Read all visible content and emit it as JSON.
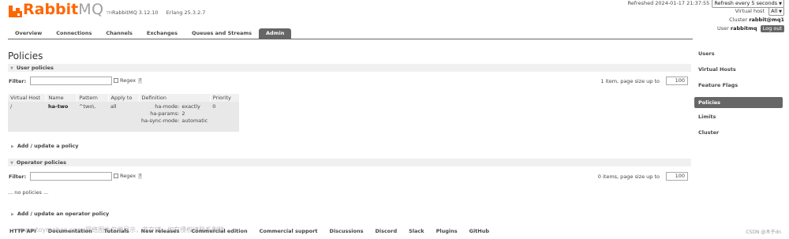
{
  "header": {
    "logo_rabbit": "Rabbit",
    "logo_mq": "MQ",
    "logo_tm": "TM",
    "version_rabbitmq": "RabbitMQ 3.12.10",
    "version_erlang": "Erlang 25.3.2.7",
    "refreshed": "Refreshed 2024-01-17 21:37:55",
    "refresh_select": "Refresh every 5 seconds",
    "virtual_host_label": "Virtual host",
    "virtual_host_value": "All",
    "cluster_label": "Cluster",
    "cluster_value": "rabbit@mq1",
    "user_label": "User",
    "user_value": "rabbitmq",
    "logout_label": "Log out"
  },
  "tabs": [
    "Overview",
    "Connections",
    "Channels",
    "Exchanges",
    "Queues and Streams",
    "Admin"
  ],
  "active_tab": "Admin",
  "page_title": "Policies",
  "user_policies": {
    "header": "User policies",
    "filter_label": "Filter:",
    "regex_label": "Regex",
    "help": "?",
    "page_info": "1 item, page size up to",
    "page_size": "100",
    "columns": [
      "Virtual Host",
      "Name",
      "Pattern",
      "Apply to",
      "Definition",
      "Priority"
    ],
    "row": {
      "vhost": "/",
      "name": "ha-two",
      "pattern": "^two\\.",
      "apply_to": "all",
      "definition": [
        {
          "key": "ha-mode:",
          "value": "exactly"
        },
        {
          "key": "ha-params:",
          "value": "2"
        },
        {
          "key": "ha-sync-mode:",
          "value": "automatic"
        }
      ],
      "priority": "0"
    },
    "add_link": "Add / update a policy"
  },
  "operator_policies": {
    "header": "Operator policies",
    "filter_label": "Filter:",
    "regex_label": "Regex",
    "help": "?",
    "page_info": "0 items, page size up to",
    "page_size": "100",
    "empty": "... no policies ...",
    "add_link": "Add / update an operator policy"
  },
  "sidebar": [
    "Users",
    "Virtual Hosts",
    "Feature Flags",
    "Policies",
    "Limits",
    "Cluster"
  ],
  "sidebar_active": "Policies",
  "footer": [
    "HTTP API",
    "Documentation",
    "Tutorials",
    "New releases",
    "Commercial edition",
    "Commercial support",
    "Discussions",
    "Discord",
    "Slack",
    "Plugins",
    "GitHub"
  ],
  "footer_right": "CSDN @木子dn",
  "watermark": "www.toymoban.com 网络图片仅供展示，非存储，如有侵权请联系删除。",
  "colors": {
    "brand": "#ff6600",
    "tab_active": "#666666"
  }
}
